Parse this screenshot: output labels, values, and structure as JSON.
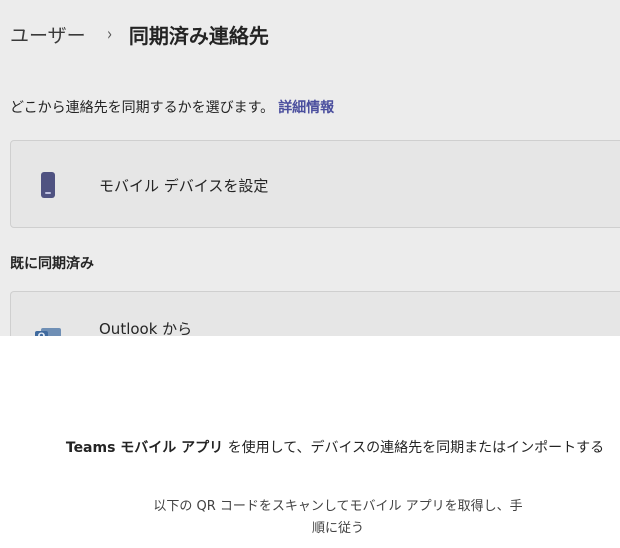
{
  "breadcrumb": {
    "parent": "ユーザー",
    "separator": "›",
    "current": "同期済み連絡先"
  },
  "description": {
    "text": "どこから連絡先を同期するかを選びます。",
    "link": "詳細情報"
  },
  "mobile_card": {
    "icon": "mobile-phone-icon",
    "label": "モバイル デバイスを設定"
  },
  "synced_section": {
    "title": "既に同期済み",
    "outlook_card": {
      "icon": "outlook-icon",
      "badge_letter": "O",
      "label": "Outlook から"
    }
  },
  "sheet": {
    "title_app": "Teams モバイル アプリ",
    "title_rest": " を使用して、デバイスの連絡先を同期またはインポートする",
    "body_line1": "以下の QR コードをスキャンしてモバイル アプリを取得し、手",
    "body_line2": "順に従う"
  },
  "colors": {
    "link": "#4b4f9e",
    "phone_icon": "#4f5281",
    "outlook_blue": "#3f6a9e",
    "dimmed_background": "#ececec",
    "sheet_background": "#ffffff"
  }
}
